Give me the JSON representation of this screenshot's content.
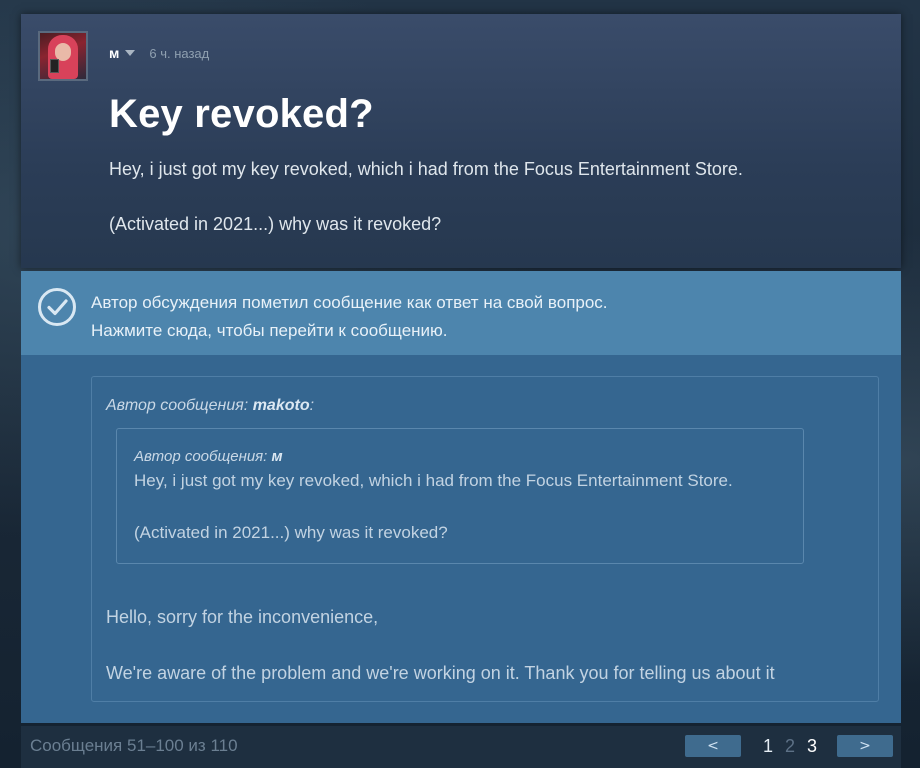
{
  "post": {
    "author": "м",
    "timestamp": "6 ч. назад",
    "title": "Key revoked?",
    "body": [
      "Hey, i just got my key revoked, which i had from the Focus Entertainment Store.",
      "(Activated in 2021...) why was it revoked?"
    ]
  },
  "answer_banner": {
    "line1": "Автор обсуждения пометил сообщение как ответ на свой вопрос.",
    "line2": "Нажмите сюда, чтобы перейти к сообщению."
  },
  "reply": {
    "outer_quote_label": "Автор сообщения:",
    "outer_quote_author": "makoto",
    "outer_quote_suffix": ":",
    "inner_quote_label": "Автор сообщения:",
    "inner_quote_author": "м",
    "inner_quote_body": [
      "Hey, i just got my key revoked, which i had from the Focus Entertainment Store.",
      "(Activated in 2021...) why was it revoked?"
    ],
    "body": [
      "Hello, sorry for the inconvenience,",
      "We're aware of the problem and we're working on it. Thank you for telling us about it"
    ]
  },
  "footer": {
    "count_text": "Сообщения 51–100 из 110",
    "prev_label": "<",
    "next_label": ">",
    "pages": [
      "1",
      "2",
      "3"
    ],
    "current_page": "3"
  },
  "colors": {
    "op_bg": "#2b3d57",
    "answer_bg": "#4d85ad",
    "reply_bg": "#356690",
    "footer_bg": "#1e2f40"
  },
  "icons": {
    "answer": "checkmark-circle-icon",
    "author_menu": "chevron-down-icon"
  }
}
